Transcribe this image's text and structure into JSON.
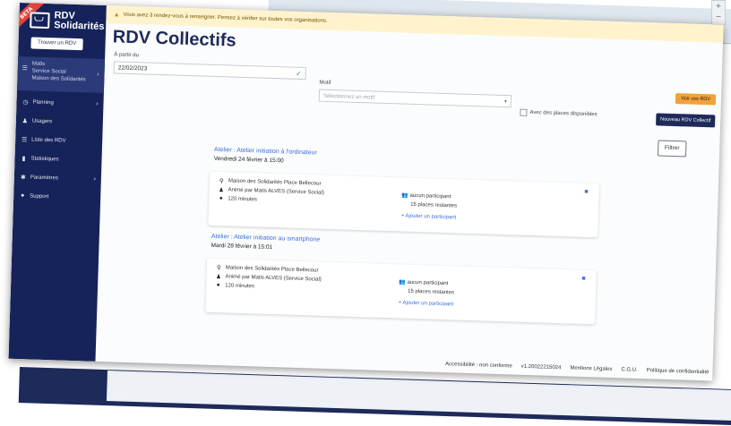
{
  "app": {
    "name_line1": "RDV",
    "name_line2": "Solidarités",
    "beta_badge": "BETA"
  },
  "sidebar": {
    "find_button": "Trouver un RDV",
    "context": {
      "user": "Matis",
      "service": "Service Social",
      "org": "Maison des Solidarités"
    },
    "items": [
      {
        "label": "Planning",
        "icon": "calendar-icon",
        "has_children": true
      },
      {
        "label": "Usagers",
        "icon": "user-icon",
        "has_children": false
      },
      {
        "label": "Liste des RDV",
        "icon": "list-icon",
        "has_children": false
      },
      {
        "label": "Statistiques",
        "icon": "stats-icon",
        "has_children": false
      },
      {
        "label": "Paramètres",
        "icon": "gear-icon",
        "has_children": true
      },
      {
        "label": "Support",
        "icon": "help-icon",
        "has_children": false
      }
    ]
  },
  "alert": {
    "text": "Vous avez 3 rendez-vous à renseigner. Pensez à vérifier sur toutes vos organisations."
  },
  "page": {
    "title": "RDV Collectifs",
    "voir_button": "Voir ces RDV",
    "new_button": "Nouveau RDV Collectif"
  },
  "filters": {
    "date_label": "À partir du",
    "date_value": "22/02/2023",
    "motif_label": "Motif",
    "motif_placeholder": "Sélectionnez un motif",
    "availability_label": "Avec des places disponibles",
    "filter_button": "Filtrer"
  },
  "rdvs": [
    {
      "title": "Atelier : Atelier initiation à l'ordinateur",
      "date": "Vendredi 24 février à 15:00",
      "place": "Maison des Solidarités Place Bellecour",
      "agent": "Animé par Matis ALVES (Service Social)",
      "duration": "120 minutes",
      "participants": "aucun participant",
      "remaining": "15 places restantes",
      "add_participant": "Ajouter un participant"
    },
    {
      "title": "Atelier : Atelier initiation au smartphone",
      "date": "Mardi 28 février à 15:01",
      "place": "Maison des Solidarités Place Bellecour",
      "agent": "Animé par Matis ALVES (Service Social)",
      "duration": "120 minutes",
      "participants": "aucun participant",
      "remaining": "15 places restantes",
      "add_participant": "Ajouter un participant"
    }
  ],
  "footer": {
    "accessibility": "Accessibilité : non conforme",
    "version": "v1.20022215024",
    "legal": "Mentions Légales",
    "cgu": "C.G.U.",
    "privacy": "Politique de confidentialité"
  },
  "colors": {
    "sidebar_bg": "#16235a",
    "alert_bg": "#fff3cd",
    "accent_orange": "#f1a23a",
    "link_blue": "#3a6fd6"
  }
}
